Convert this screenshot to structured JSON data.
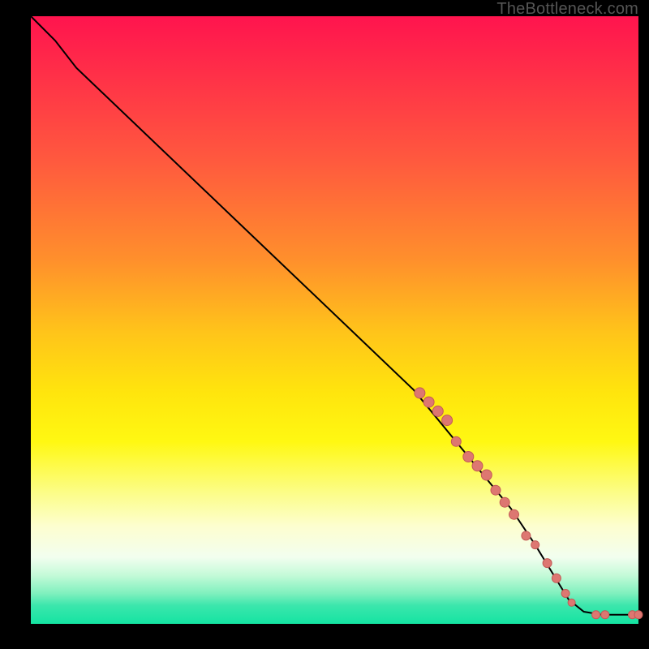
{
  "watermark_text": "TheBottleneck.com",
  "colors": {
    "marker_fill": "#dd7771",
    "marker_stroke": "#c35a56",
    "curve_stroke": "#000000",
    "frame_bg": "#000000"
  },
  "chart_data": {
    "type": "line",
    "title": "",
    "xlabel": "",
    "ylabel": "",
    "xlim": [
      0,
      100
    ],
    "ylim": [
      0,
      100
    ],
    "curve": {
      "name": "bottleneck curve",
      "points": [
        {
          "x": 0.0,
          "y": 100.0
        },
        {
          "x": 4.0,
          "y": 96.0
        },
        {
          "x": 7.5,
          "y": 91.5
        },
        {
          "x": 63.0,
          "y": 38.5
        },
        {
          "x": 79.0,
          "y": 19.0
        },
        {
          "x": 83.0,
          "y": 13.0
        },
        {
          "x": 88.5,
          "y": 4.0
        },
        {
          "x": 91.0,
          "y": 2.0
        },
        {
          "x": 94.0,
          "y": 1.5
        },
        {
          "x": 97.5,
          "y": 1.5
        },
        {
          "x": 100.0,
          "y": 1.5
        }
      ]
    },
    "series": [
      {
        "name": "highlighted points",
        "type": "scatter",
        "points": [
          {
            "x": 64.0,
            "y": 38.0,
            "r": 6.5
          },
          {
            "x": 65.5,
            "y": 36.5,
            "r": 6.5
          },
          {
            "x": 67.0,
            "y": 35.0,
            "r": 6.5
          },
          {
            "x": 68.5,
            "y": 33.5,
            "r": 6.5
          },
          {
            "x": 70.0,
            "y": 30.0,
            "r": 6.0
          },
          {
            "x": 72.0,
            "y": 27.5,
            "r": 6.5
          },
          {
            "x": 73.5,
            "y": 26.0,
            "r": 6.5
          },
          {
            "x": 75.0,
            "y": 24.5,
            "r": 6.5
          },
          {
            "x": 76.5,
            "y": 22.0,
            "r": 6.0
          },
          {
            "x": 78.0,
            "y": 20.0,
            "r": 6.0
          },
          {
            "x": 79.5,
            "y": 18.0,
            "r": 6.0
          },
          {
            "x": 81.5,
            "y": 14.5,
            "r": 5.5
          },
          {
            "x": 83.0,
            "y": 13.0,
            "r": 5.0
          },
          {
            "x": 85.0,
            "y": 10.0,
            "r": 5.5
          },
          {
            "x": 86.5,
            "y": 7.5,
            "r": 5.5
          },
          {
            "x": 88.0,
            "y": 5.0,
            "r": 5.0
          },
          {
            "x": 89.0,
            "y": 3.5,
            "r": 4.5
          },
          {
            "x": 93.0,
            "y": 1.5,
            "r": 5.0
          },
          {
            "x": 94.5,
            "y": 1.5,
            "r": 5.0
          },
          {
            "x": 99.0,
            "y": 1.5,
            "r": 5.0
          },
          {
            "x": 100.0,
            "y": 1.5,
            "r": 5.0
          }
        ]
      }
    ]
  }
}
